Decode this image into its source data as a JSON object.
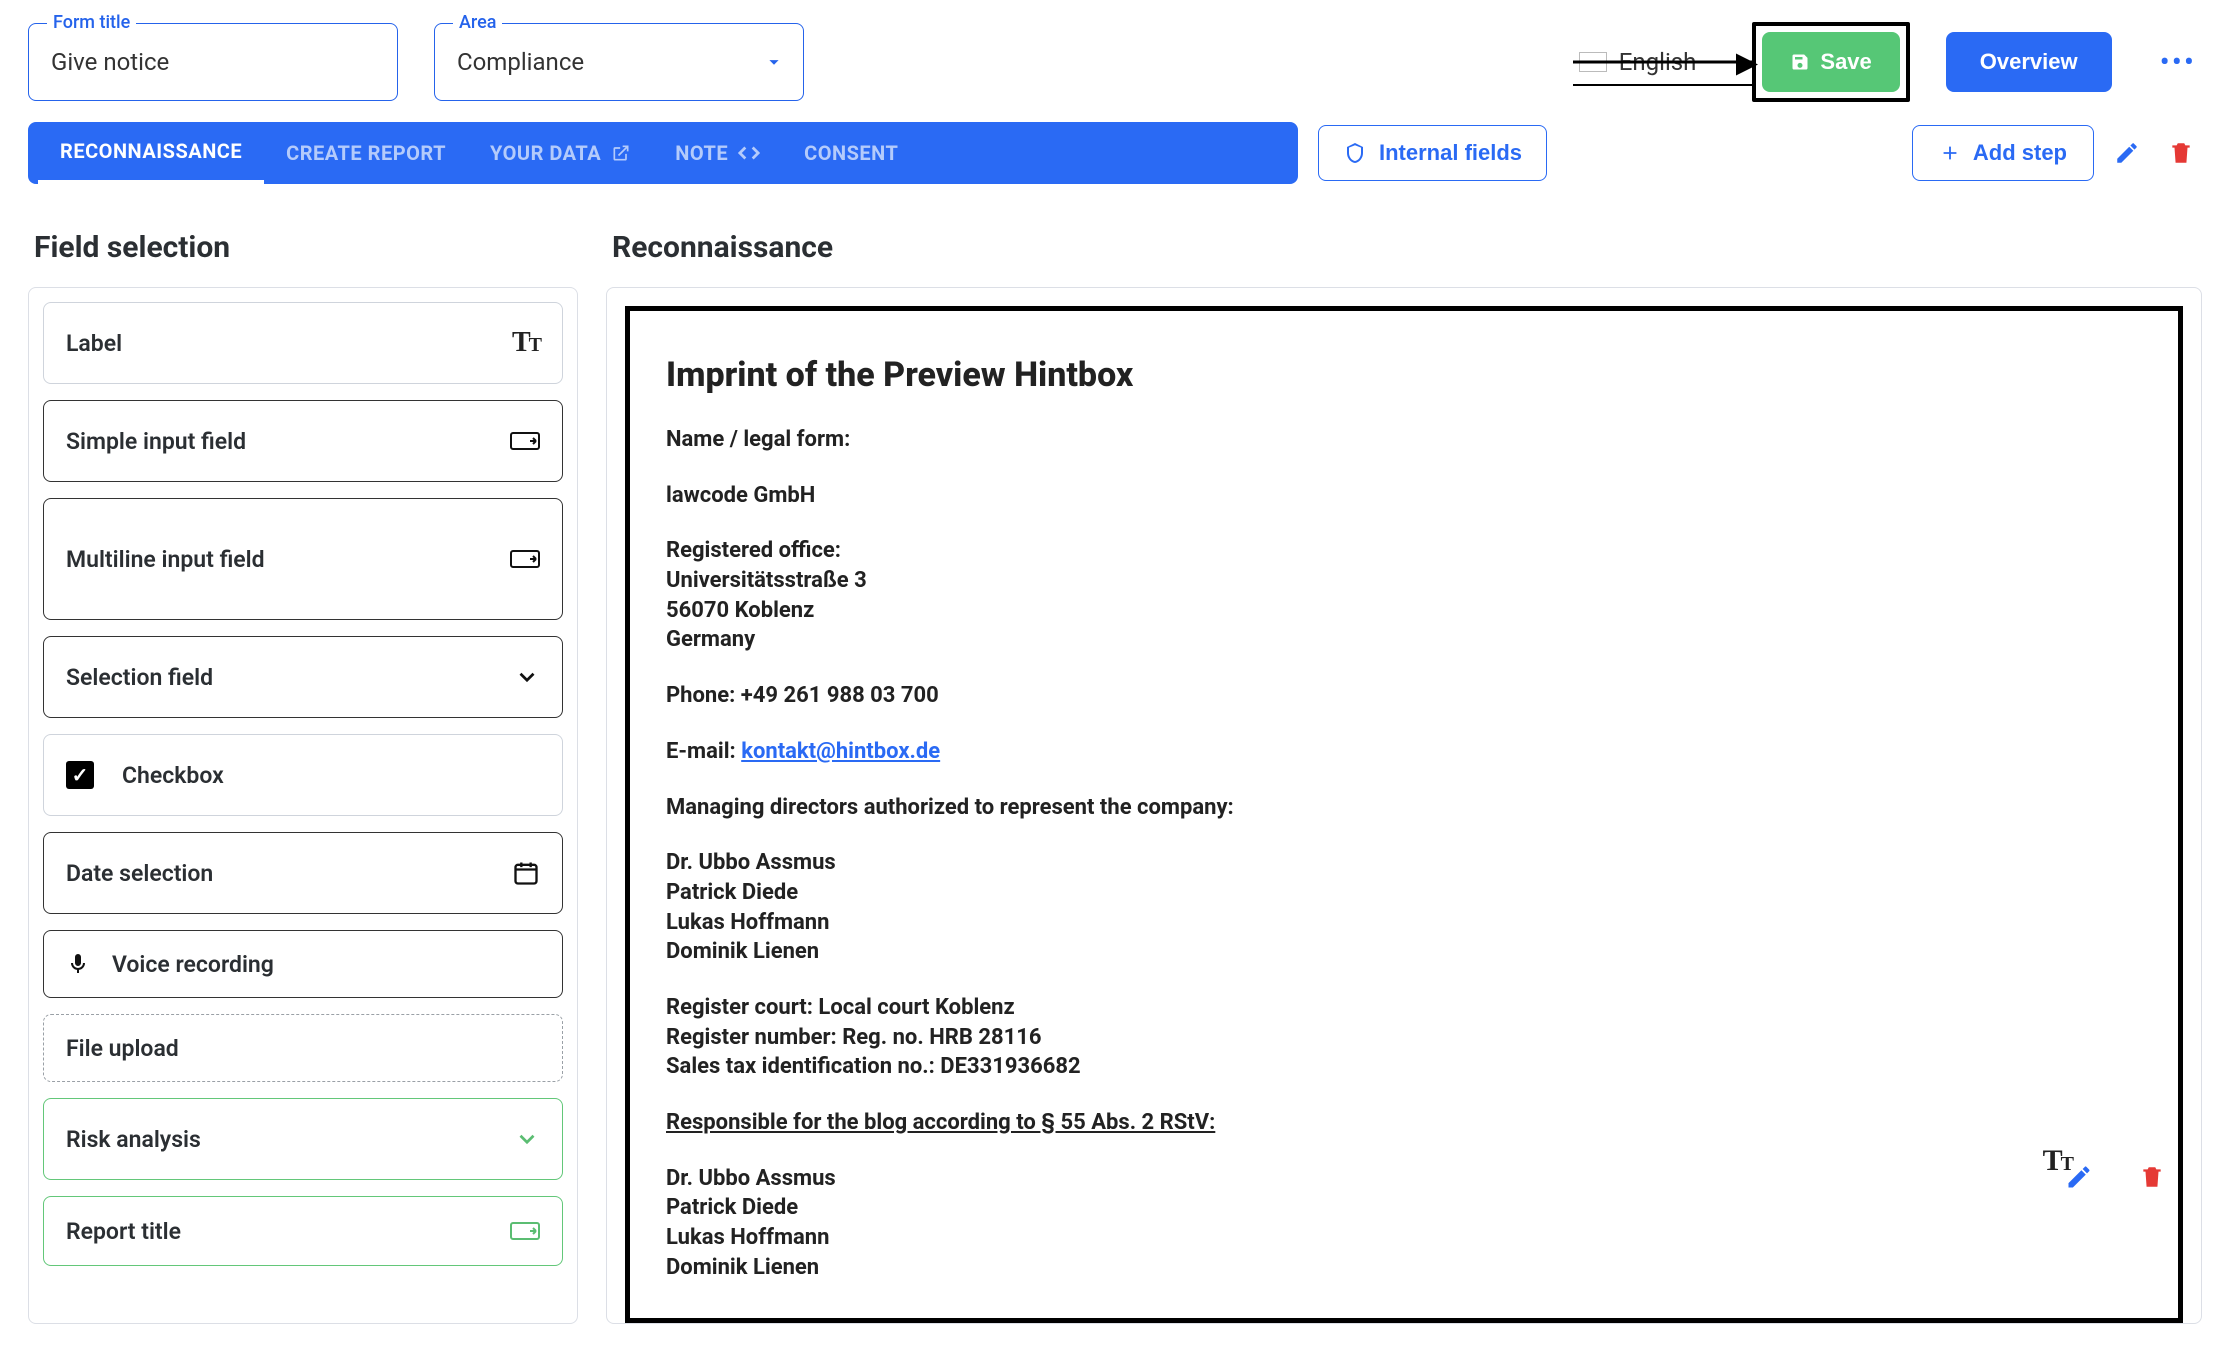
{
  "header": {
    "form_title_label": "Form title",
    "form_title_value": "Give notice",
    "area_label": "Area",
    "area_value": "Compliance",
    "language": "English",
    "save_label": "Save",
    "overview_label": "Overview"
  },
  "tabs": {
    "items": [
      {
        "label": "RECONNAISSANCE",
        "active": true
      },
      {
        "label": "CREATE REPORT"
      },
      {
        "label": "YOUR DATA",
        "trailing_icon": "external-link-icon"
      },
      {
        "label": "NOTE",
        "trailing_icon": "code-icon"
      },
      {
        "label": "CONSENT"
      }
    ],
    "internal_fields_label": "Internal fields",
    "add_step_label": "Add step"
  },
  "left": {
    "heading": "Field selection",
    "fields": [
      {
        "name": "label",
        "label": "Label",
        "icon": "text-format-icon",
        "style": "light"
      },
      {
        "name": "simple-input",
        "label": "Simple input field",
        "icon": "input-icon"
      },
      {
        "name": "multiline-input",
        "label": "Multiline input field",
        "icon": "input-icon",
        "tall": true
      },
      {
        "name": "selection-field",
        "label": "Selection field",
        "icon": "chevron-down-icon"
      },
      {
        "name": "checkbox",
        "label": "Checkbox",
        "icon": "checkbox-icon",
        "style": "light",
        "lead": true
      },
      {
        "name": "date-selection",
        "label": "Date selection",
        "icon": "calendar-icon"
      },
      {
        "name": "voice-recording",
        "label": "Voice recording",
        "icon": "mic-icon",
        "lead": true
      },
      {
        "name": "file-upload",
        "label": "File upload",
        "style": "dashed"
      },
      {
        "name": "risk-analysis",
        "label": "Risk analysis",
        "icon": "chevron-down-icon",
        "style": "green"
      },
      {
        "name": "report-title",
        "label": "Report title",
        "icon": "input-icon",
        "style": "green"
      }
    ]
  },
  "right": {
    "heading": "Reconnaissance",
    "imprint": {
      "title": "Imprint of the Preview Hintbox",
      "name_label": "Name / legal form:",
      "company": "lawcode GmbH",
      "office_label": "Registered office:",
      "address1": "Universitätsstraße 3",
      "address2": "56070 Koblenz",
      "country": "Germany",
      "phone_line": "Phone: +49 261 988 03 700",
      "email_label": "E-mail: ",
      "email": "kontakt@hintbox.de",
      "md_label": "Managing directors authorized to represent the company:",
      "directors": [
        "Dr. Ubbo Assmus",
        "Patrick Diede",
        "Lukas Hoffmann",
        "Dominik Lienen"
      ],
      "reg_court": "Register court: Local court Koblenz",
      "reg_number": "Register number: Reg. no. HRB 28116",
      "vat": "Sales tax identification no.: DE331936682",
      "resp_label": "Responsible for the blog according to § 55 Abs. 2 RStV:",
      "responsible": [
        "Dr. Ubbo Assmus",
        "Patrick Diede",
        "Lukas Hoffmann",
        "Dominik Lienen"
      ]
    }
  }
}
